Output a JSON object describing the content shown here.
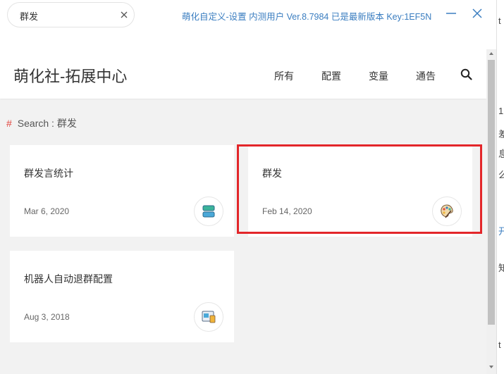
{
  "topbar": {
    "search_value": "群发",
    "status": "萌化自定义-设置 内测用户 Ver.8.7984  已是最新版本  Key:1EF5N"
  },
  "header": {
    "title": "萌化社-拓展中心",
    "nav": [
      "所有",
      "配置",
      "变量",
      "通告"
    ]
  },
  "breadcrumb": {
    "hash": "#",
    "text": "Search : 群发"
  },
  "cards": [
    {
      "title": "群发言统计",
      "date": "Mar 6, 2020",
      "icon": "stack-icon"
    },
    {
      "title": "群发",
      "date": "Feb 14, 2020",
      "icon": "palette-icon"
    },
    {
      "title": "机器人自动退群配置",
      "date": "Aug 3, 2018",
      "icon": "window-icon"
    }
  ],
  "highlight_color": "#e3262a",
  "accent_color": "#3a7dc0",
  "background_fragments": [
    "t",
    "1",
    "差",
    "息",
    "么",
    "开",
    "知",
    "t"
  ]
}
